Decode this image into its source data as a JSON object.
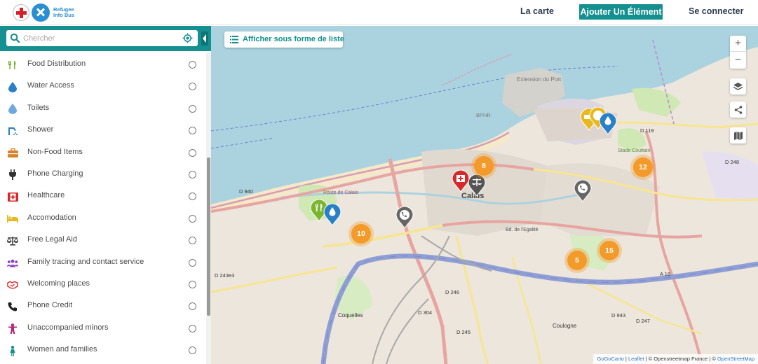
{
  "header": {
    "logo_line1": "Refugee",
    "logo_line2": "Info Bus",
    "nav_map": "La carte",
    "nav_add": "Ajouter Un Élément",
    "nav_login": "Se connecter"
  },
  "search": {
    "placeholder": "Chercher"
  },
  "categories": [
    {
      "label": "Food Distribution",
      "icon": "utensils-icon",
      "color": "#7ab52e"
    },
    {
      "label": "Water Access",
      "icon": "water-drop-icon",
      "color": "#2a7fc9"
    },
    {
      "label": "Toilets",
      "icon": "toilet-drop-icon",
      "color": "#6fa8dc"
    },
    {
      "label": "Shower",
      "icon": "shower-icon",
      "color": "#2a7fc9"
    },
    {
      "label": "Non-Food Items",
      "icon": "briefcase-icon",
      "color": "#d9822b"
    },
    {
      "label": "Phone Charging",
      "icon": "plug-icon",
      "color": "#333333"
    },
    {
      "label": "Healthcare",
      "icon": "first-aid-icon",
      "color": "#d62a2a"
    },
    {
      "label": "Accomodation",
      "icon": "bed-icon",
      "color": "#e8b91e"
    },
    {
      "label": "Free Legal Aid",
      "icon": "scales-icon",
      "color": "#444444"
    },
    {
      "label": "Family tracing and contact service",
      "icon": "people-icon",
      "color": "#8a3fc6"
    },
    {
      "label": "Welcoming places",
      "icon": "handshake-icon",
      "color": "#d62a2a"
    },
    {
      "label": "Phone Credit",
      "icon": "phone-icon",
      "color": "#222222"
    },
    {
      "label": "Unaccompanied minors",
      "icon": "child-icon",
      "color": "#b3287b"
    },
    {
      "label": "Women and families",
      "icon": "woman-icon",
      "color": "#13908f"
    }
  ],
  "map": {
    "list_button": "Afficher sous forme de liste",
    "zoom_in": "+",
    "zoom_out": "−",
    "clusters": [
      "8",
      "12",
      "10",
      "15",
      "5"
    ],
    "labels": {
      "city": "Calais",
      "port_ext": "Extension du Port",
      "bphr": "BPHR",
      "coquelles": "Coquelles",
      "coulogne": "Coulogne",
      "stade": "Stade Couttain",
      "d940": "D 940",
      "d119": "D 119",
      "d248": "D 248",
      "d247": "D 247",
      "d243": "D 243e3",
      "d304": "D 304",
      "d943": "D 943",
      "a16": "A 16",
      "d246": "D 246",
      "d245": "D 245",
      "route_calais": "Route de Calais",
      "rue_bd": "Bd. de l'Egalité"
    },
    "attribution_gogo": "GoGoCarto",
    "attribution_leaflet": "Leaflet",
    "attribution_mid": " | © Openstreetmap France | © ",
    "attribution_osm": "OpenStreetMap"
  }
}
